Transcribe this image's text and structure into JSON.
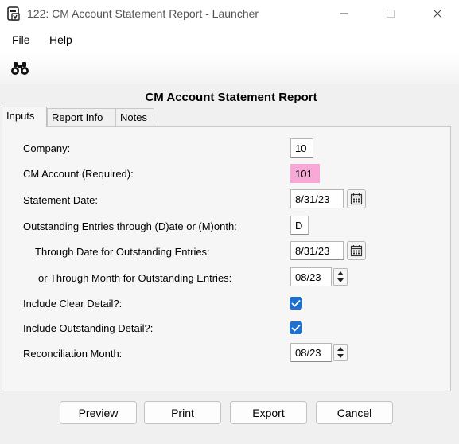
{
  "window": {
    "title": "122: CM Account Statement Report - Launcher",
    "icons": {
      "app": "report-app-icon",
      "minimize": "minimize-icon",
      "maximize": "maximize-icon",
      "close": "close-icon"
    }
  },
  "menu": {
    "items": [
      "File",
      "Help"
    ]
  },
  "toolbar": {
    "icon": "binoculars-icon"
  },
  "report_title": "CM Account Statement Report",
  "tabs": [
    "Inputs",
    "Report Info",
    "Notes"
  ],
  "active_tab": "Inputs",
  "fields": {
    "company": {
      "label": "Company:",
      "value": "10"
    },
    "cm_account": {
      "label": "CM Account (Required):",
      "value": "101",
      "highlight_color": "#f7a8d6"
    },
    "statement_date": {
      "label": "Statement Date:",
      "value": "8/31/23"
    },
    "outstanding_through": {
      "label": "Outstanding Entries through (D)ate or (M)onth:",
      "value": "D"
    },
    "through_date": {
      "label": "Through Date for Outstanding Entries:",
      "value": "8/31/23"
    },
    "through_month": {
      "label": "or Through Month for Outstanding Entries:",
      "value": "08/23"
    },
    "include_clear": {
      "label": "Include Clear Detail?:",
      "checked": true
    },
    "include_outstanding": {
      "label": "Include Outstanding Detail?:",
      "checked": true
    },
    "recon_month": {
      "label": "Reconciliation Month:",
      "value": "08/23"
    }
  },
  "buttons": {
    "preview": "Preview",
    "print": "Print",
    "export": "Export",
    "cancel": "Cancel"
  },
  "colors": {
    "checkbox": "#1f6fce",
    "required_field": "#f7a8d6"
  }
}
